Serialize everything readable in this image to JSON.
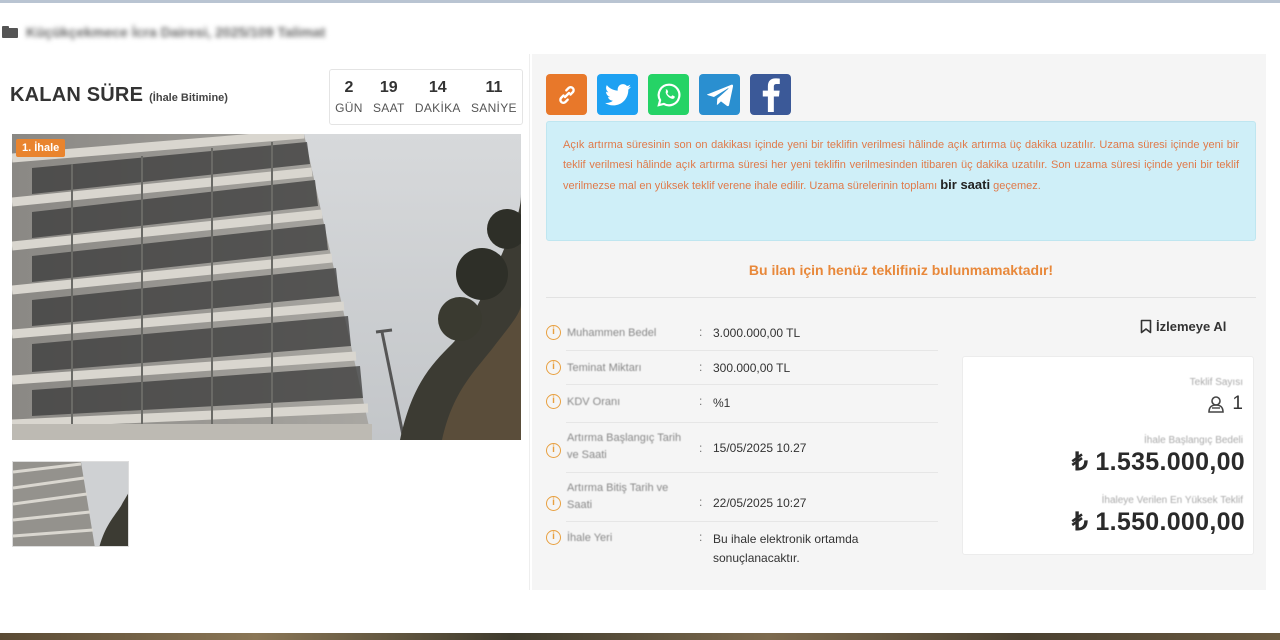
{
  "breadcrumb": {
    "icon": "folder-icon",
    "text": "Küçükçekmece İcra Dairesi, 2025/109 Talimat"
  },
  "countdown": {
    "title": "KALAN SÜRE",
    "subtitle": "(İhale Bitimine)",
    "units": [
      {
        "value": "2",
        "label": "GÜN"
      },
      {
        "value": "19",
        "label": "SAAT"
      },
      {
        "value": "14",
        "label": "DAKİKA"
      },
      {
        "value": "11",
        "label": "SANİYE"
      }
    ]
  },
  "gallery": {
    "badge": "1. İhale"
  },
  "share": {
    "buttons": [
      {
        "icon": "link-icon",
        "color": "#e8782a"
      },
      {
        "icon": "twitter-icon",
        "color": "#1da1f2"
      },
      {
        "icon": "whatsapp-icon",
        "color": "#25d366"
      },
      {
        "icon": "telegram-icon",
        "color": "#2a8fd0"
      },
      {
        "icon": "facebook-icon",
        "color": "#3b5998"
      }
    ]
  },
  "notice": {
    "text_before": "Açık artırma süresinin son on dakikası içinde yeni bir teklifin verilmesi hâlinde açık artırma üç dakika uzatılır. Uzama süresi içinde yeni bir teklif verilmesi hâlinde açık artırma süresi her yeni teklifin verilmesinden itibaren üç dakika uzatılır. Son uzama süresi içinde yeni bir teklif verilmezse mal en yüksek teklif verene ihale edilir. Uzama sürelerinin toplamı",
    "emphasis": "bir saati",
    "text_after": "geçemez."
  },
  "no_bid_message": "Bu ilan için henüz teklifiniz bulunmamaktadır!",
  "details": [
    {
      "label": "Muhammen Bedel",
      "value": "3.000.000,00 TL"
    },
    {
      "label": "Teminat Miktarı",
      "value": "300.000,00 TL"
    },
    {
      "label": "KDV Oranı",
      "value": "%1"
    },
    {
      "label": "Artırma Başlangıç Tarih ve Saati",
      "value": "15/05/2025 10.27"
    },
    {
      "label": "Artırma Bitiş Tarih ve Saati",
      "value": "22/05/2025 10:27"
    },
    {
      "label": "İhale Yeri",
      "value": "Bu ihale elektronik ortamda sonuçlanacaktır."
    }
  ],
  "watch_button": "İzlemeye Al",
  "summary": {
    "bid_count_label": "Teklif Sayısı",
    "bid_count": "1",
    "start_price_label": "İhale Başlangıç Bedeli",
    "start_price": "₺ 1.535.000,00",
    "highest_bid_label": "İhaleye Verilen En Yüksek Teklif",
    "highest_bid": "₺ 1.550.000,00"
  },
  "colors": {
    "accent": "#e8883a",
    "notice_bg": "#cfeff8",
    "notice_text": "#e07a4a"
  }
}
